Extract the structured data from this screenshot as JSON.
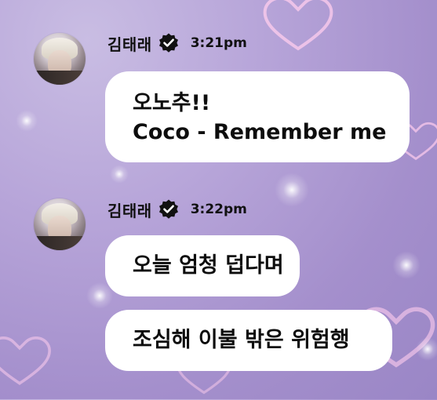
{
  "messages": [
    {
      "sender": "김태래",
      "time": "3:21pm",
      "bubbles": [
        {
          "lines": [
            "오노추!!",
            "Coco - Remember me"
          ]
        }
      ]
    },
    {
      "sender": "김태래",
      "time": "3:22pm",
      "bubbles": [
        {
          "lines": [
            "오늘 엄청 덥다며"
          ]
        },
        {
          "lines": [
            "조심해 이불 밖은 위험행"
          ]
        }
      ]
    }
  ],
  "icons": {
    "verified": "verified-badge-icon",
    "avatar": "profile-avatar"
  },
  "colors": {
    "background": "#b7a5d9",
    "bubble": "#ffffff",
    "text": "#111111",
    "heart_glow": "#f3b8e6"
  }
}
